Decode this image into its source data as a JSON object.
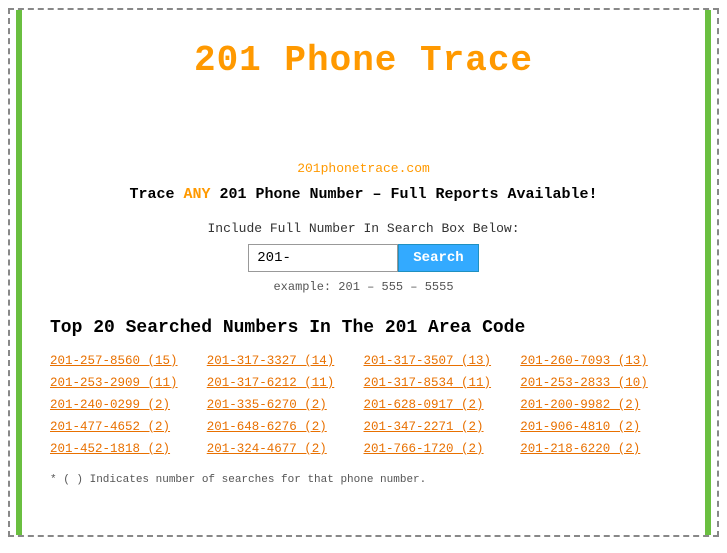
{
  "page": {
    "title": "201 Phone Trace",
    "site_url": "201phonetrace.com",
    "tagline_prefix": "Trace ",
    "tagline_any": "ANY",
    "tagline_suffix": " 201 Phone Number – Full Reports Available!",
    "search_label": "Include Full Number In Search Box Below:",
    "search_value": "201-",
    "search_button": "Search",
    "search_example": "example: 201 – 555 – 5555",
    "top_section_title": "Top 20 Searched Numbers In The 201 Area Code",
    "footnote": "* ( ) Indicates number of searches for that phone number."
  },
  "phone_numbers": [
    [
      "201-257-8560 (15)",
      "201-317-3327 (14)",
      "201-317-3507 (13)",
      "201-260-7093 (13)"
    ],
    [
      "201-253-2909 (11)",
      "201-317-6212 (11)",
      "201-317-8534 (11)",
      "201-253-2833 (10)"
    ],
    [
      "201-240-0299 (2)",
      "201-335-6270 (2)",
      "201-628-0917 (2)",
      "201-200-9982 (2)"
    ],
    [
      "201-477-4652 (2)",
      "201-648-6276 (2)",
      "201-347-2271 (2)",
      "201-906-4810 (2)"
    ],
    [
      "201-452-1818 (2)",
      "201-324-4677 (2)",
      "201-766-1720 (2)",
      "201-218-6220 (2)"
    ]
  ]
}
